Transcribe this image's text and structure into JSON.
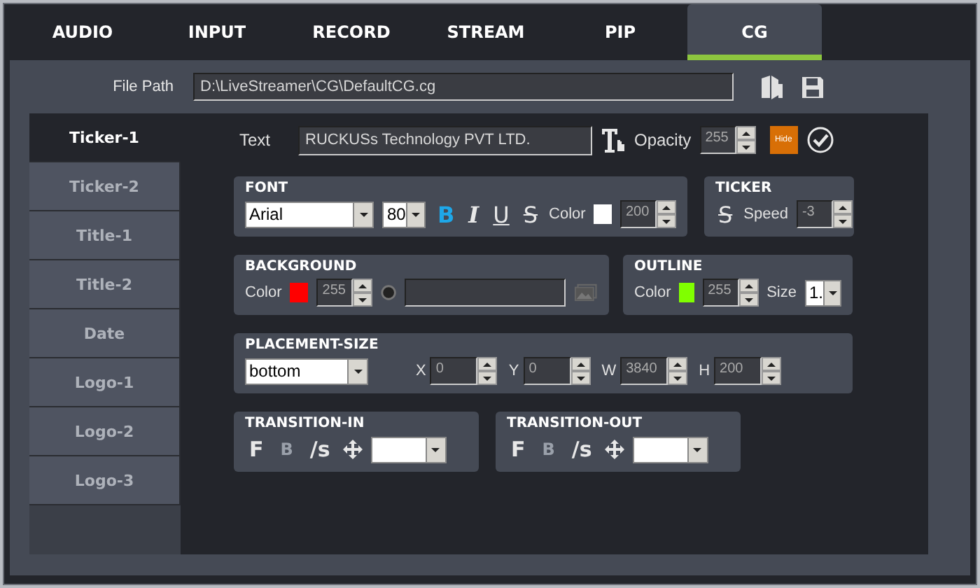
{
  "tabs": [
    {
      "label": "AUDIO",
      "selected": false
    },
    {
      "label": "INPUT",
      "selected": false
    },
    {
      "label": "RECORD",
      "selected": false
    },
    {
      "label": "STREAM",
      "selected": false
    },
    {
      "label": "PIP",
      "selected": false
    },
    {
      "label": "CG",
      "selected": true
    }
  ],
  "file_path": {
    "label": "File Path",
    "value": "D:\\LiveStreamer\\CG\\DefaultCG.cg"
  },
  "sidebar": {
    "items": [
      {
        "label": "Ticker-1",
        "selected": true
      },
      {
        "label": "Ticker-2",
        "selected": false
      },
      {
        "label": "Title-1",
        "selected": false
      },
      {
        "label": "Title-2",
        "selected": false
      },
      {
        "label": "Date",
        "selected": false
      },
      {
        "label": "Logo-1",
        "selected": false
      },
      {
        "label": "Logo-2",
        "selected": false
      },
      {
        "label": "Logo-3",
        "selected": false
      }
    ]
  },
  "text_row": {
    "label": "Text",
    "value": "RUCKUSs Technology PVT LTD.",
    "opacity_label": "Opacity",
    "opacity": "255",
    "hide_button": "Hide"
  },
  "font": {
    "title": "FONT",
    "family": "Arial",
    "size": "80",
    "styles": [
      {
        "glyph": "B",
        "kind": "bold",
        "on": true
      },
      {
        "glyph": "I",
        "kind": "italic",
        "on": false
      },
      {
        "glyph": "U",
        "kind": "underline",
        "on": false
      },
      {
        "glyph": "S",
        "kind": "strike",
        "on": false
      }
    ],
    "color_label": "Color",
    "color": "#ffffff",
    "alpha": "200"
  },
  "ticker": {
    "title": "TICKER",
    "glyph": "S",
    "speed_label": "Speed",
    "speed": "-3"
  },
  "background": {
    "title": "BACKGROUND",
    "color_label": "Color",
    "color": "#ff0000",
    "alpha": "255"
  },
  "outline": {
    "title": "OUTLINE",
    "color_label": "Color",
    "color": "#80ff00",
    "alpha": "255",
    "size_label": "Size",
    "size": "1."
  },
  "placement": {
    "title": "PLACEMENT-SIZE",
    "position": "bottom",
    "fields": [
      {
        "label": "X",
        "value": "0"
      },
      {
        "label": "Y",
        "value": "0"
      },
      {
        "label": "W",
        "value": "3840"
      },
      {
        "label": "H",
        "value": "200"
      }
    ]
  },
  "transitions": [
    {
      "title": "TRANSITION-IN",
      "glyphs": [
        "F",
        "B",
        "/s"
      ]
    },
    {
      "title": "TRANSITION-OUT",
      "glyphs": [
        "F",
        "B",
        "/s"
      ]
    }
  ]
}
